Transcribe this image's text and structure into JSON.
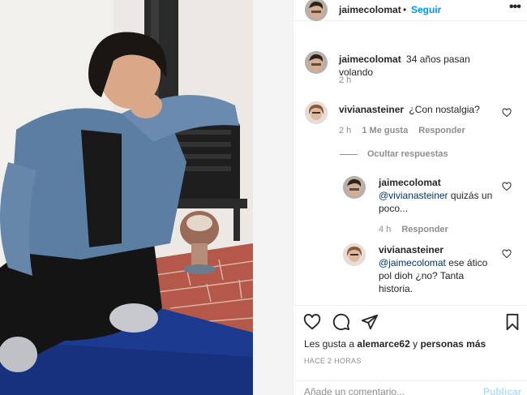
{
  "post": {
    "author": "jaimecolomat",
    "dot": "•",
    "follow_label": "Seguir",
    "more_label": "•••",
    "caption_user": "jaimecolomat",
    "caption_text": "34 años pasan volando",
    "caption_time": "2 h"
  },
  "comments": [
    {
      "user": "vivianasteiner",
      "text": "¿Con nostalgia?",
      "time": "2 h",
      "likes": "1 Me gusta",
      "reply_label": "Responder"
    }
  ],
  "replies_toggle": "Ocultar respuestas",
  "replies": [
    {
      "user": "jaimecolomat",
      "mention": "@vivianasteiner",
      "text": " quizás un poco...",
      "time": "4 h",
      "reply_label": "Responder"
    },
    {
      "user": "vivianasteiner",
      "mention": "@jaimecolomat",
      "text": " ese ático pol dioh ¿no? Tanta historia."
    }
  ],
  "likes": {
    "prefix": "Les gusta a",
    "user": "alemarce62",
    "connector": "y",
    "others": "personas más"
  },
  "timestamp": "HACE 2 HORAS",
  "composer": {
    "placeholder": "Añade un comentario...",
    "publish_label": "Publicar"
  },
  "icons": [
    "heart-icon",
    "comment-icon",
    "share-icon",
    "bookmark-icon",
    "more-icon"
  ],
  "colors": {
    "accent": "#0095f6",
    "publish_disabled": "#b2dffc",
    "muted": "#8e8e8e",
    "text": "#262626",
    "mention": "#00376b"
  }
}
